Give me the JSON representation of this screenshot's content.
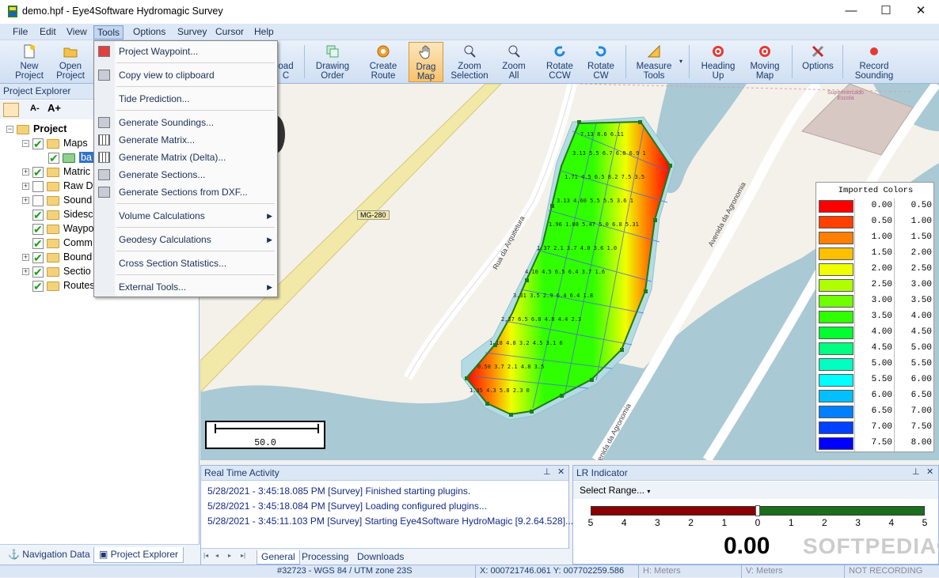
{
  "window": {
    "title": "demo.hpf - Eye4Software Hydromagic Survey",
    "minimize": "—",
    "maximize": "☐",
    "close": "✕"
  },
  "menubar": [
    "File",
    "Edit",
    "View",
    "Tools",
    "Options",
    "Survey",
    "Cursor",
    "Help"
  ],
  "toolbar": {
    "new_project": [
      "New",
      "Project"
    ],
    "open_project": [
      "Open",
      "Project"
    ],
    "download": [
      "oad",
      "C"
    ],
    "drawing_order": [
      "Drawing",
      "Order"
    ],
    "create_route": [
      "Create",
      "Route"
    ],
    "drag_map": [
      "Drag",
      "Map"
    ],
    "zoom_selection": [
      "Zoom",
      "Selection"
    ],
    "zoom_all": [
      "Zoom",
      "All"
    ],
    "rotate_ccw": [
      "Rotate",
      "CCW"
    ],
    "rotate_cw": [
      "Rotate",
      "CW"
    ],
    "measure_tools": [
      "Measure",
      "Tools"
    ],
    "heading_up": [
      "Heading",
      "Up"
    ],
    "moving_map": [
      "Moving",
      "Map"
    ],
    "options": [
      "Options",
      ""
    ],
    "record_sounding": [
      "Record",
      "Sounding"
    ]
  },
  "project_explorer": {
    "title": "Project Explorer",
    "font_smaller": "A-",
    "font_larger": "A+",
    "tree": [
      {
        "label": "Project",
        "bold": true,
        "level": 0,
        "checked": null,
        "expander": "−"
      },
      {
        "label": "Maps",
        "level": 1,
        "checked": true,
        "expander": "−"
      },
      {
        "label": "ba",
        "level": 2,
        "checked": true,
        "expander": "",
        "selected": true
      },
      {
        "label": "Matric",
        "level": 1,
        "checked": true,
        "expander": "+"
      },
      {
        "label": "Raw D",
        "level": 1,
        "checked": false,
        "expander": "+"
      },
      {
        "label": "Sound",
        "level": 1,
        "checked": false,
        "expander": "+"
      },
      {
        "label": "Sidesc",
        "level": 1,
        "checked": true,
        "expander": ""
      },
      {
        "label": "Waypo",
        "level": 1,
        "checked": true,
        "expander": ""
      },
      {
        "label": "Comm",
        "level": 1,
        "checked": true,
        "expander": ""
      },
      {
        "label": "Bound",
        "level": 1,
        "checked": true,
        "expander": "+"
      },
      {
        "label": "Sectio",
        "level": 1,
        "checked": true,
        "expander": "+"
      },
      {
        "label": "Routes",
        "level": 1,
        "checked": true,
        "expander": ""
      }
    ],
    "tabs": [
      "Navigation Data",
      "Project Explorer"
    ]
  },
  "tools_menu": [
    {
      "label": "Project Waypoint...",
      "icon": "waypoint-icon",
      "sub": false
    },
    {
      "sep": true
    },
    {
      "label": "Copy view to clipboard",
      "icon": "clipboard-icon",
      "sub": false
    },
    {
      "sep": true
    },
    {
      "label": "Tide Prediction...",
      "icon": "",
      "sub": false
    },
    {
      "sep": true
    },
    {
      "label": "Generate Soundings...",
      "icon": "soundings-icon",
      "sub": false
    },
    {
      "label": "Generate Matrix...",
      "icon": "matrix-icon",
      "sub": false
    },
    {
      "label": "Generate Matrix (Delta)...",
      "icon": "matrix-delta-icon",
      "sub": false
    },
    {
      "label": "Generate Sections...",
      "icon": "sections-icon",
      "sub": false
    },
    {
      "label": "Generate Sections from DXF...",
      "icon": "dxf-icon",
      "sub": false
    },
    {
      "sep": true
    },
    {
      "label": "Volume Calculations",
      "icon": "",
      "sub": true
    },
    {
      "sep": true
    },
    {
      "label": "Geodesy Calculations",
      "icon": "",
      "sub": true
    },
    {
      "sep": true
    },
    {
      "label": "Cross Section Statistics...",
      "icon": "",
      "sub": false
    },
    {
      "sep": true
    },
    {
      "label": "External Tools...",
      "icon": "",
      "sub": true
    }
  ],
  "map": {
    "road_labels": [
      "MG-280",
      "Rua da Arquitetura",
      "Avenida da Agronomia",
      "Avenida da Agronomia"
    ],
    "poi": [
      "Supermercado",
      "Escola"
    ],
    "scale_label": "50.0"
  },
  "legend": {
    "title": "Imported Colors",
    "rows": [
      {
        "color": "#ff0000",
        "from": "0.00",
        "to": "0.50"
      },
      {
        "color": "#ff4000",
        "from": "0.50",
        "to": "1.00"
      },
      {
        "color": "#ff8000",
        "from": "1.00",
        "to": "1.50"
      },
      {
        "color": "#ffc000",
        "from": "1.50",
        "to": "2.00"
      },
      {
        "color": "#f0ff00",
        "from": "2.00",
        "to": "2.50"
      },
      {
        "color": "#b0ff00",
        "from": "2.50",
        "to": "3.00"
      },
      {
        "color": "#70ff00",
        "from": "3.00",
        "to": "3.50"
      },
      {
        "color": "#30ff00",
        "from": "3.50",
        "to": "4.00"
      },
      {
        "color": "#00ff30",
        "from": "4.00",
        "to": "4.50"
      },
      {
        "color": "#00ff80",
        "from": "4.50",
        "to": "5.00"
      },
      {
        "color": "#00ffc0",
        "from": "5.00",
        "to": "5.50"
      },
      {
        "color": "#00ffff",
        "from": "5.50",
        "to": "6.00"
      },
      {
        "color": "#00c0ff",
        "from": "6.00",
        "to": "6.50"
      },
      {
        "color": "#0080ff",
        "from": "6.50",
        "to": "7.00"
      },
      {
        "color": "#0040ff",
        "from": "7.00",
        "to": "7.50"
      },
      {
        "color": "#0000ff",
        "from": "7.50",
        "to": "8.00"
      }
    ]
  },
  "realtime": {
    "title": "Real Time Activity",
    "pin": "ᵽ",
    "close": "✕",
    "log": [
      "5/28/2021 - 3:45:18.085 PM [Survey] Finished starting plugins.",
      "5/28/2021 - 3:45:18.084 PM [Survey] Loading configured plugins...",
      "5/28/2021 - 3:45:11.103 PM [Survey] Starting Eye4Software HydroMagic [9.2.64.528]..."
    ],
    "nav": [
      "|◂",
      "◂",
      "▸",
      "▸|"
    ],
    "tabs": [
      "General",
      "Processing",
      "Downloads"
    ]
  },
  "lr": {
    "title": "LR Indicator",
    "select_range": "Select Range...",
    "scale": [
      "5",
      "4",
      "3",
      "2",
      "1",
      "0",
      "1",
      "2",
      "3",
      "4",
      "5"
    ],
    "value": "0.00",
    "watermark": "SOFTPEDIA®"
  },
  "status": {
    "epsg": "#32723 - WGS 84 / UTM zone 23S",
    "coords": "X: 000721746.061  Y: 007702259.586",
    "h_units": "H: Meters",
    "v_units": "V: Meters",
    "recording": "NOT RECORDING"
  }
}
